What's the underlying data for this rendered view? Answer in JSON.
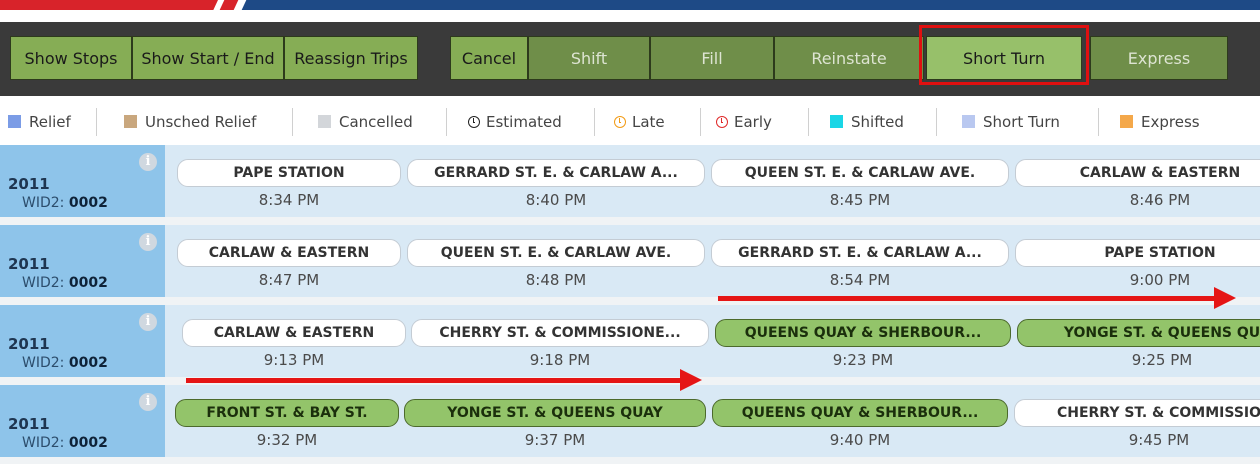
{
  "toolbar": {
    "buttons": [
      {
        "label": "Show Stops"
      },
      {
        "label": "Show Start / End"
      },
      {
        "label": "Reassign Trips"
      },
      {
        "label": "Cancel"
      },
      {
        "label": "Shift"
      },
      {
        "label": "Fill"
      },
      {
        "label": "Reinstate"
      },
      {
        "label": "Short Turn"
      },
      {
        "label": "Express"
      }
    ]
  },
  "legend": [
    {
      "label": "Relief",
      "color": "#7b9ce6"
    },
    {
      "label": "Unsched Relief",
      "color": "#c9a77e"
    },
    {
      "label": "Cancelled",
      "color": "#d3d6da"
    },
    {
      "label": "Estimated",
      "icon": "clock-icon"
    },
    {
      "label": "Late",
      "icon": "clock-icon",
      "color": "#f29b16"
    },
    {
      "label": "Early",
      "icon": "clock-icon",
      "color": "#e02a2a"
    },
    {
      "label": "Shifted",
      "color": "#1ad6e6"
    },
    {
      "label": "Short Turn",
      "color": "#b9c8f0"
    },
    {
      "label": "Express",
      "color": "#f4a84a"
    }
  ],
  "rows": [
    {
      "run": "2011",
      "wid_label": "WID2:",
      "wid": "0002",
      "stops": [
        {
          "name": "PAPE STATION",
          "time": "8:34 PM",
          "express": false
        },
        {
          "name": "GERRARD ST. E. & CARLAW A...",
          "time": "8:40 PM",
          "express": false
        },
        {
          "name": "QUEEN ST. E. & CARLAW AVE.",
          "time": "8:45 PM",
          "express": false
        },
        {
          "name": "CARLAW & EASTERN",
          "time": "8:46 PM",
          "express": false
        }
      ]
    },
    {
      "run": "2011",
      "wid_label": "WID2:",
      "wid": "0002",
      "stops": [
        {
          "name": "CARLAW & EASTERN",
          "time": "8:47 PM",
          "express": false
        },
        {
          "name": "QUEEN ST. E. & CARLAW AVE.",
          "time": "8:48 PM",
          "express": false
        },
        {
          "name": "GERRARD ST. E. & CARLAW A...",
          "time": "8:54 PM",
          "express": false
        },
        {
          "name": "PAPE STATION",
          "time": "9:00 PM",
          "express": false
        }
      ]
    },
    {
      "run": "2011",
      "wid_label": "WID2:",
      "wid": "0002",
      "stops": [
        {
          "name": "CARLAW & EASTERN",
          "time": "9:13 PM",
          "express": false
        },
        {
          "name": "CHERRY ST. & COMMISSIONE...",
          "time": "9:18 PM",
          "express": false
        },
        {
          "name": "QUEENS QUAY & SHERBOUR...",
          "time": "9:23 PM",
          "express": true
        },
        {
          "name": "YONGE ST. & QUEENS QU",
          "time": "9:25 PM",
          "express": true
        }
      ]
    },
    {
      "run": "2011",
      "wid_label": "WID2:",
      "wid": "0002",
      "stops": [
        {
          "name": "FRONT ST. & BAY ST.",
          "time": "9:32 PM",
          "express": true
        },
        {
          "name": "YONGE ST. & QUEENS QUAY",
          "time": "9:37 PM",
          "express": true
        },
        {
          "name": "QUEENS QUAY & SHERBOUR...",
          "time": "9:40 PM",
          "express": true
        },
        {
          "name": "CHERRY ST. & COMMISSIO",
          "time": "9:45 PM",
          "express": false
        }
      ]
    }
  ]
}
